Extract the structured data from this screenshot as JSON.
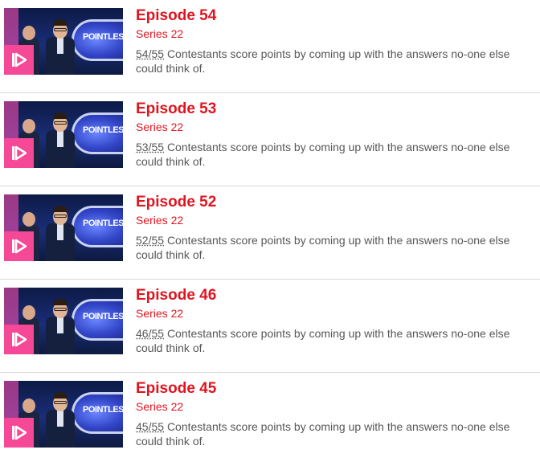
{
  "episodes": [
    {
      "title": "Episode 54",
      "series": "Series 22",
      "availability": "54/55",
      "description": "Contestants score points by coming up with the answers no-one else could think of.",
      "thumb_logo": "POINTLESS"
    },
    {
      "title": "Episode 53",
      "series": "Series 22",
      "availability": "53/55",
      "description": "Contestants score points by coming up with the answers no-one else could think of.",
      "thumb_logo": "POINTLESS"
    },
    {
      "title": "Episode 52",
      "series": "Series 22",
      "availability": "52/55",
      "description": "Contestants score points by coming up with the answers no-one else could think of.",
      "thumb_logo": "POINTLESS"
    },
    {
      "title": "Episode 46",
      "series": "Series 22",
      "availability": "46/55",
      "description": "Contestants score points by coming up with the answers no-one else could think of.",
      "thumb_logo": "POINTLESS"
    },
    {
      "title": "Episode 45",
      "series": "Series 22",
      "availability": "45/55",
      "description": "Contestants score points by coming up with the answers no-one else could think of.",
      "thumb_logo": "POINTLESS"
    }
  ],
  "colors": {
    "accent": "#e0141e",
    "badge": "#f54997",
    "text": "#575757"
  },
  "badge_icon": "iplayer-play-icon"
}
